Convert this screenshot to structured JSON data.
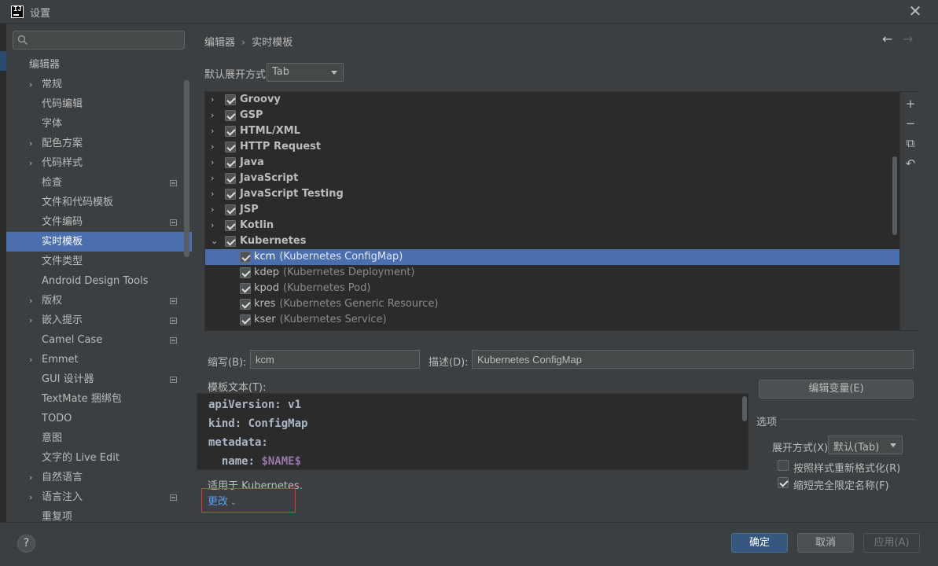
{
  "window": {
    "title": "设置",
    "close_symbol": "✕"
  },
  "sidebar": {
    "search_placeholder": "",
    "items": [
      {
        "label": "编辑器",
        "arrow": "",
        "mini": false,
        "selected": false,
        "level": 0
      },
      {
        "label": "常规",
        "arrow": "›",
        "mini": false,
        "selected": false,
        "level": 1
      },
      {
        "label": "代码编辑",
        "arrow": "",
        "mini": false,
        "selected": false,
        "level": 1
      },
      {
        "label": "字体",
        "arrow": "",
        "mini": false,
        "selected": false,
        "level": 1
      },
      {
        "label": "配色方案",
        "arrow": "›",
        "mini": false,
        "selected": false,
        "level": 1
      },
      {
        "label": "代码样式",
        "arrow": "›",
        "mini": false,
        "selected": false,
        "level": 1
      },
      {
        "label": "检查",
        "arrow": "",
        "mini": true,
        "selected": false,
        "level": 1
      },
      {
        "label": "文件和代码模板",
        "arrow": "",
        "mini": false,
        "selected": false,
        "level": 1
      },
      {
        "label": "文件编码",
        "arrow": "",
        "mini": true,
        "selected": false,
        "level": 1
      },
      {
        "label": "实时模板",
        "arrow": "",
        "mini": false,
        "selected": true,
        "level": 1
      },
      {
        "label": "文件类型",
        "arrow": "",
        "mini": false,
        "selected": false,
        "level": 1
      },
      {
        "label": "Android Design Tools",
        "arrow": "",
        "mini": false,
        "selected": false,
        "level": 1
      },
      {
        "label": "版权",
        "arrow": "›",
        "mini": true,
        "selected": false,
        "level": 1
      },
      {
        "label": "嵌入提示",
        "arrow": "›",
        "mini": true,
        "selected": false,
        "level": 1
      },
      {
        "label": "Camel Case",
        "arrow": "",
        "mini": true,
        "selected": false,
        "level": 1
      },
      {
        "label": "Emmet",
        "arrow": "›",
        "mini": false,
        "selected": false,
        "level": 1
      },
      {
        "label": "GUI 设计器",
        "arrow": "",
        "mini": true,
        "selected": false,
        "level": 1
      },
      {
        "label": "TextMate 捆绑包",
        "arrow": "",
        "mini": false,
        "selected": false,
        "level": 1
      },
      {
        "label": "TODO",
        "arrow": "",
        "mini": false,
        "selected": false,
        "level": 1
      },
      {
        "label": "意图",
        "arrow": "",
        "mini": false,
        "selected": false,
        "level": 1
      },
      {
        "label": "文字的 Live Edit",
        "arrow": "",
        "mini": false,
        "selected": false,
        "level": 1
      },
      {
        "label": "自然语言",
        "arrow": "›",
        "mini": false,
        "selected": false,
        "level": 1
      },
      {
        "label": "语言注入",
        "arrow": "›",
        "mini": true,
        "selected": false,
        "level": 1
      },
      {
        "label": "重复项",
        "arrow": "",
        "mini": false,
        "selected": false,
        "level": 1
      }
    ]
  },
  "breadcrumb": {
    "parent": "编辑器",
    "separator": "›",
    "current": "实时模板"
  },
  "nav": {
    "back": "←",
    "forward": "→"
  },
  "expand_default": {
    "label": "默认展开方式",
    "value": "Tab"
  },
  "templates": [
    {
      "name": "Groovy",
      "type": "group",
      "expanded": false,
      "selected": false
    },
    {
      "name": "GSP",
      "type": "group",
      "expanded": false,
      "selected": false
    },
    {
      "name": "HTML/XML",
      "type": "group",
      "expanded": false,
      "selected": false
    },
    {
      "name": "HTTP Request",
      "type": "group",
      "expanded": false,
      "selected": false
    },
    {
      "name": "Java",
      "type": "group",
      "expanded": false,
      "selected": false
    },
    {
      "name": "JavaScript",
      "type": "group",
      "expanded": false,
      "selected": false
    },
    {
      "name": "JavaScript Testing",
      "type": "group",
      "expanded": false,
      "selected": false
    },
    {
      "name": "JSP",
      "type": "group",
      "expanded": false,
      "selected": false
    },
    {
      "name": "Kotlin",
      "type": "group",
      "expanded": false,
      "selected": false
    },
    {
      "name": "Kubernetes",
      "type": "group",
      "expanded": true,
      "selected": false
    },
    {
      "name": "kcm",
      "desc": "(Kubernetes ConfigMap)",
      "type": "leaf",
      "selected": true
    },
    {
      "name": "kdep",
      "desc": "(Kubernetes Deployment)",
      "type": "leaf",
      "selected": false
    },
    {
      "name": "kpod",
      "desc": "(Kubernetes Pod)",
      "type": "leaf",
      "selected": false
    },
    {
      "name": "kres",
      "desc": "(Kubernetes Generic Resource)",
      "type": "leaf",
      "selected": false
    },
    {
      "name": "kser",
      "desc": "(Kubernetes Service)",
      "type": "leaf",
      "selected": false
    }
  ],
  "tools": {
    "add": "+",
    "remove": "−",
    "copy": "⧉",
    "revert": "↶"
  },
  "form": {
    "abbr_label": "缩写(B):",
    "abbr_value": "kcm",
    "desc_label": "描述(D):",
    "desc_value": "Kubernetes ConfigMap",
    "template_text_label": "模板文本(T):",
    "edit_vars_button": "编辑变量(E)"
  },
  "editor_lines": [
    {
      "text": "apiVersion: v1",
      "var": ""
    },
    {
      "text": "kind: ConfigMap",
      "var": ""
    },
    {
      "text": "metadata:",
      "var": ""
    },
    {
      "text": "  name: ",
      "var": "$NAME$"
    }
  ],
  "options": {
    "title": "选项",
    "expand_label": "展开方式(X)",
    "expand_value": "默认(Tab)",
    "reformat_label": "按照样式重新格式化(R)",
    "reformat_checked": false,
    "shorten_label": "缩短完全限定名称(F)",
    "shorten_checked": true
  },
  "applicable": {
    "text": "适用于 Kubernetes.",
    "change_link": "更改",
    "chevron": "⌄"
  },
  "footer": {
    "help": "?",
    "ok": "确定",
    "cancel": "取消",
    "apply": "应用(A)"
  },
  "colors": {
    "selection": "#4b6eaf",
    "link": "#589df6",
    "highlight_box": "#e53935",
    "primary_button": "#365880"
  }
}
